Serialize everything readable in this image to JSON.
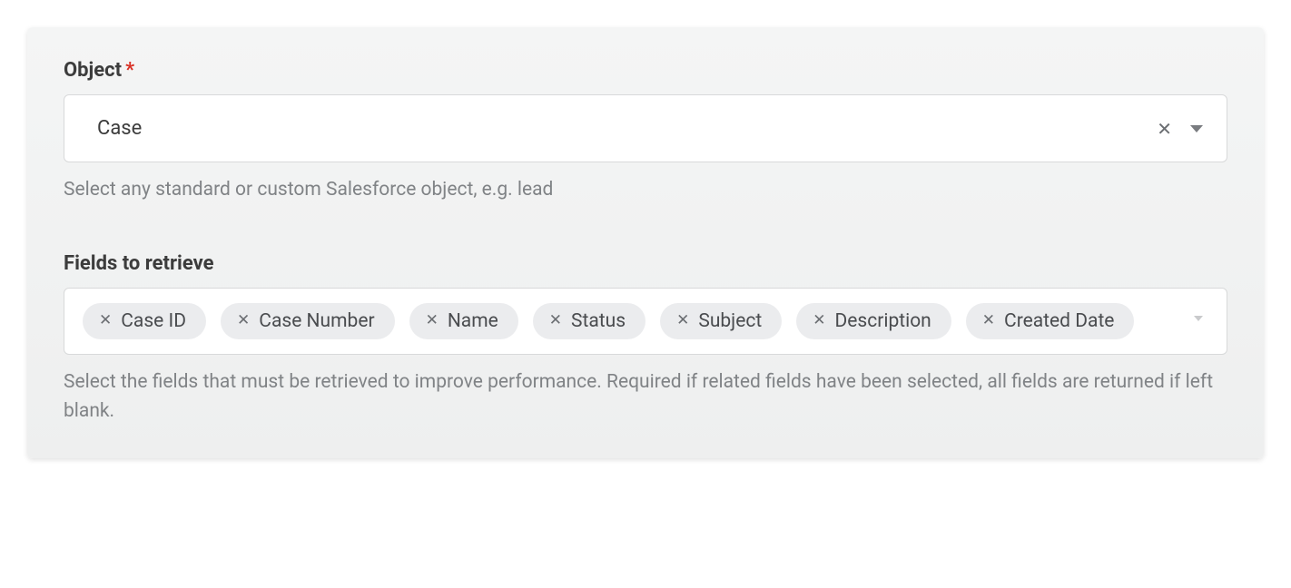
{
  "object_field": {
    "label": "Object",
    "required_marker": "*",
    "value": "Case",
    "help": "Select any standard or custom Salesforce object, e.g. lead"
  },
  "fields_field": {
    "label": "Fields to retrieve",
    "chips": [
      "Case ID",
      "Case Number",
      "Name",
      "Status",
      "Subject",
      "Description",
      "Created Date"
    ],
    "help": "Select the fields that must be retrieved to improve performance. Required if related fields have been selected, all fields are returned if left blank."
  }
}
